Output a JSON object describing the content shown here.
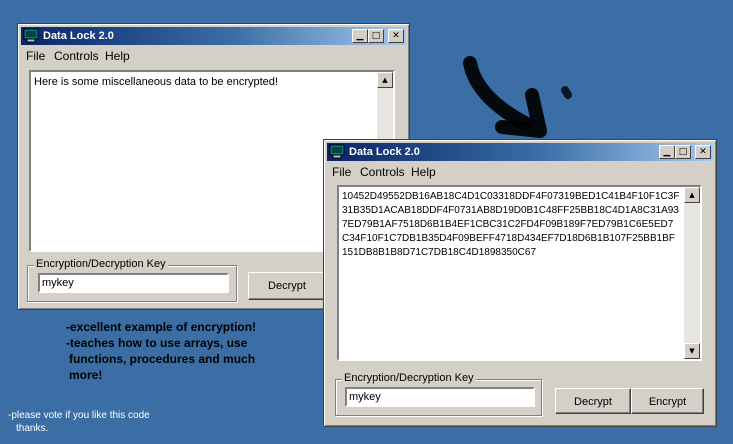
{
  "window1": {
    "title": "Data Lock 2.0",
    "menu": [
      "File",
      "Controls",
      "Help"
    ],
    "text": "Here is some miscellaneous data to be encrypted!",
    "key_label": "Encryption/Decryption Key",
    "key_value": "mykey",
    "decrypt_label": "Decrypt"
  },
  "window2": {
    "title": "Data Lock 2.0",
    "menu": [
      "File",
      "Controls",
      "Help"
    ],
    "text": "10452D49552DB16AB18C4D1C03318DDF4F07319BED1C41B4F10F1C3F31B35D1ACAB18DDF4F0731AB8D19D0B1C48FF25BB18C4D1A8C31A937ED79B1AF7518D6B1B4EF1CBC31C2FD4F09B189F7ED79B1C6E5ED7C34F10F1C7DB1B35D4F09BEFF4718D434EF7D18D6B1B107F25BB1BF151DB8B1B8D71C7DB18C4D1898350C67",
    "key_label": "Encryption/Decryption Key",
    "key_value": "mykey",
    "decrypt_label": "Decrypt",
    "encrypt_label": "Encrypt"
  },
  "captions": {
    "line1": "-excellent example of encryption!",
    "line2": "-teaches how to use arrays, use",
    "line3": "functions,  procedures and much",
    "line4": "more!"
  },
  "footer": {
    "line1": "-please vote if you like this code",
    "line2": "thanks."
  },
  "colors": {
    "desktop": "#3a6ea5",
    "title_active": "#0a246a",
    "face": "#d4d0c8"
  }
}
